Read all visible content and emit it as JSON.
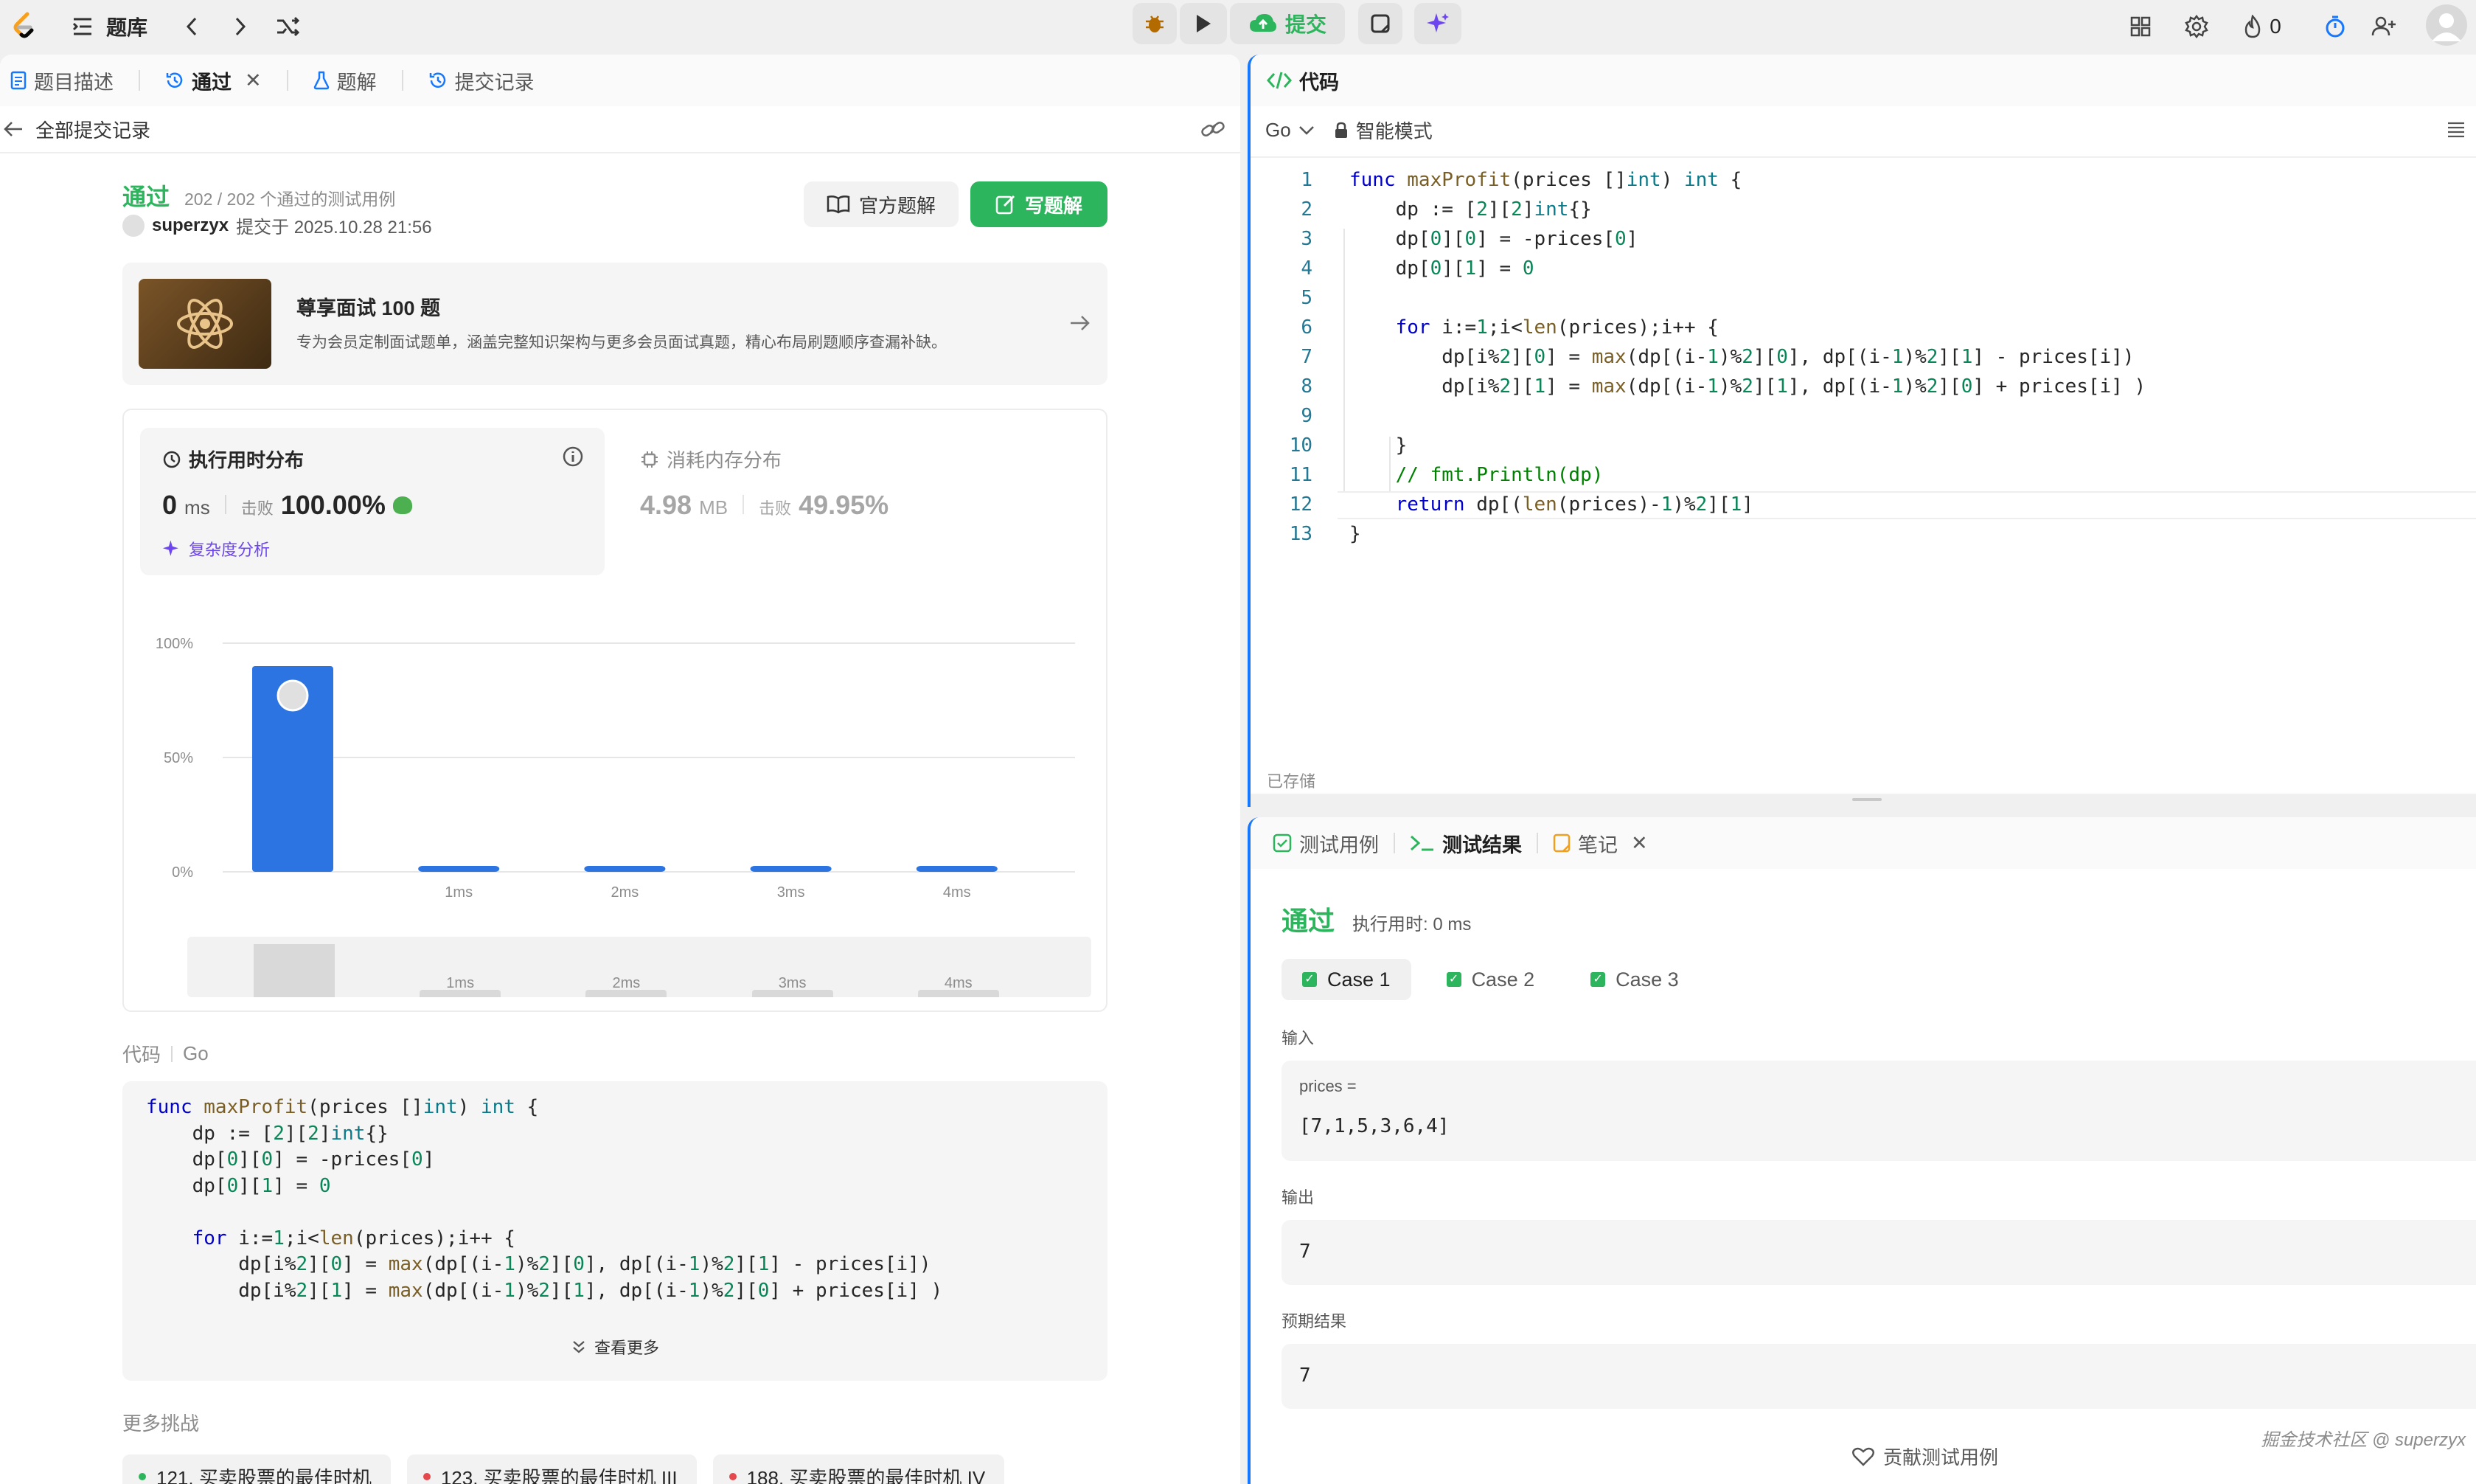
{
  "topbar": {
    "problem_bank": "题库",
    "submit": "提交",
    "streak_count": "0"
  },
  "left_tabs": [
    {
      "label": "题目描述"
    },
    {
      "label": "通过"
    },
    {
      "label": "题解"
    },
    {
      "label": "提交记录"
    }
  ],
  "back_label": "全部提交记录",
  "result": {
    "status": "通过",
    "passed_text": "202 / 202 个通过的测试用例",
    "user": "superzyx",
    "submitted_at": "提交于 2025.10.28 21:56",
    "official_solution": "官方题解",
    "write_solution": "写题解"
  },
  "promo": {
    "title": "尊享面试 100 题",
    "desc": "专为会员定制面试题单，涵盖完整知识架构与更多会员面试真题，精心布局刷题顺序查漏补缺。"
  },
  "runtime": {
    "label": "执行用时分布",
    "value": "0",
    "unit": "ms",
    "beats_label": "击败",
    "beats": "100.00%",
    "complexity": "复杂度分析"
  },
  "memory": {
    "label": "消耗内存分布",
    "value": "4.98",
    "unit": "MB",
    "beats_label": "击败",
    "beats": "49.95%"
  },
  "chart_data": {
    "type": "bar",
    "categories": [
      "0ms",
      "1ms",
      "2ms",
      "3ms",
      "4ms"
    ],
    "tick_labels": [
      "",
      "1ms",
      "2ms",
      "3ms",
      "4ms"
    ],
    "values": [
      90,
      2,
      2,
      2,
      2
    ],
    "y_ticks": [
      "100%",
      "50%",
      "0%"
    ],
    "ylim": [
      0,
      100
    ],
    "bar_color": "#2b74e2",
    "grid": true
  },
  "code_header": {
    "label": "代码",
    "lang": "Go"
  },
  "left_code": [
    "func maxProfit(prices []int) int {",
    "    dp := [2][2]int{}",
    "    dp[0][0] = -prices[0]",
    "    dp[0][1] = 0",
    "",
    "    for i:=1;i<len(prices);i++ {",
    "        dp[i%2][0] = max(dp[(i-1)%2][0], dp[(i-1)%2][1] - prices[i])",
    "        dp[i%2][1] = max(dp[(i-1)%2][1], dp[(i-1)%2][0] + prices[i] )"
  ],
  "view_more": "查看更多",
  "more_challenges": {
    "label": "更多挑战",
    "items": [
      {
        "text": "121. 买卖股票的最佳时机",
        "color": "#2db55d"
      },
      {
        "text": "123. 买卖股票的最佳时机 III",
        "color": "#e5484d"
      },
      {
        "text": "188. 买卖股票的最佳时机 IV",
        "color": "#e5484d"
      }
    ]
  },
  "editor": {
    "title": "代码",
    "lang": "Go",
    "mode": "智能模式",
    "saved": "已存储",
    "lines": [
      "func maxProfit(prices []int) int {",
      "    dp := [2][2]int{}",
      "    dp[0][0] = -prices[0]",
      "    dp[0][1] = 0",
      "",
      "    for i:=1;i<len(prices);i++ {",
      "        dp[i%2][0] = max(dp[(i-1)%2][0], dp[(i-1)%2][1] - prices[i])",
      "        dp[i%2][1] = max(dp[(i-1)%2][1], dp[(i-1)%2][0] + prices[i] )",
      "",
      "    }",
      "    // fmt.Println(dp)",
      "    return dp[(len(prices)-1)%2][1]",
      "}"
    ]
  },
  "bottom_tabs": [
    {
      "label": "测试用例"
    },
    {
      "label": "测试结果"
    },
    {
      "label": "笔记"
    }
  ],
  "test_result": {
    "status": "通过",
    "runtime": "执行用时: 0 ms",
    "cases": [
      "Case 1",
      "Case 2",
      "Case 3"
    ],
    "input_label": "输入",
    "input_var": "prices =",
    "input_value": "[7,1,5,3,6,4]",
    "output_label": "输出",
    "output_value": "7",
    "expected_label": "预期结果",
    "expected_value": "7",
    "contribute": "贡献测试用例"
  },
  "watermark": "掘金技术社区 @ superzyx"
}
